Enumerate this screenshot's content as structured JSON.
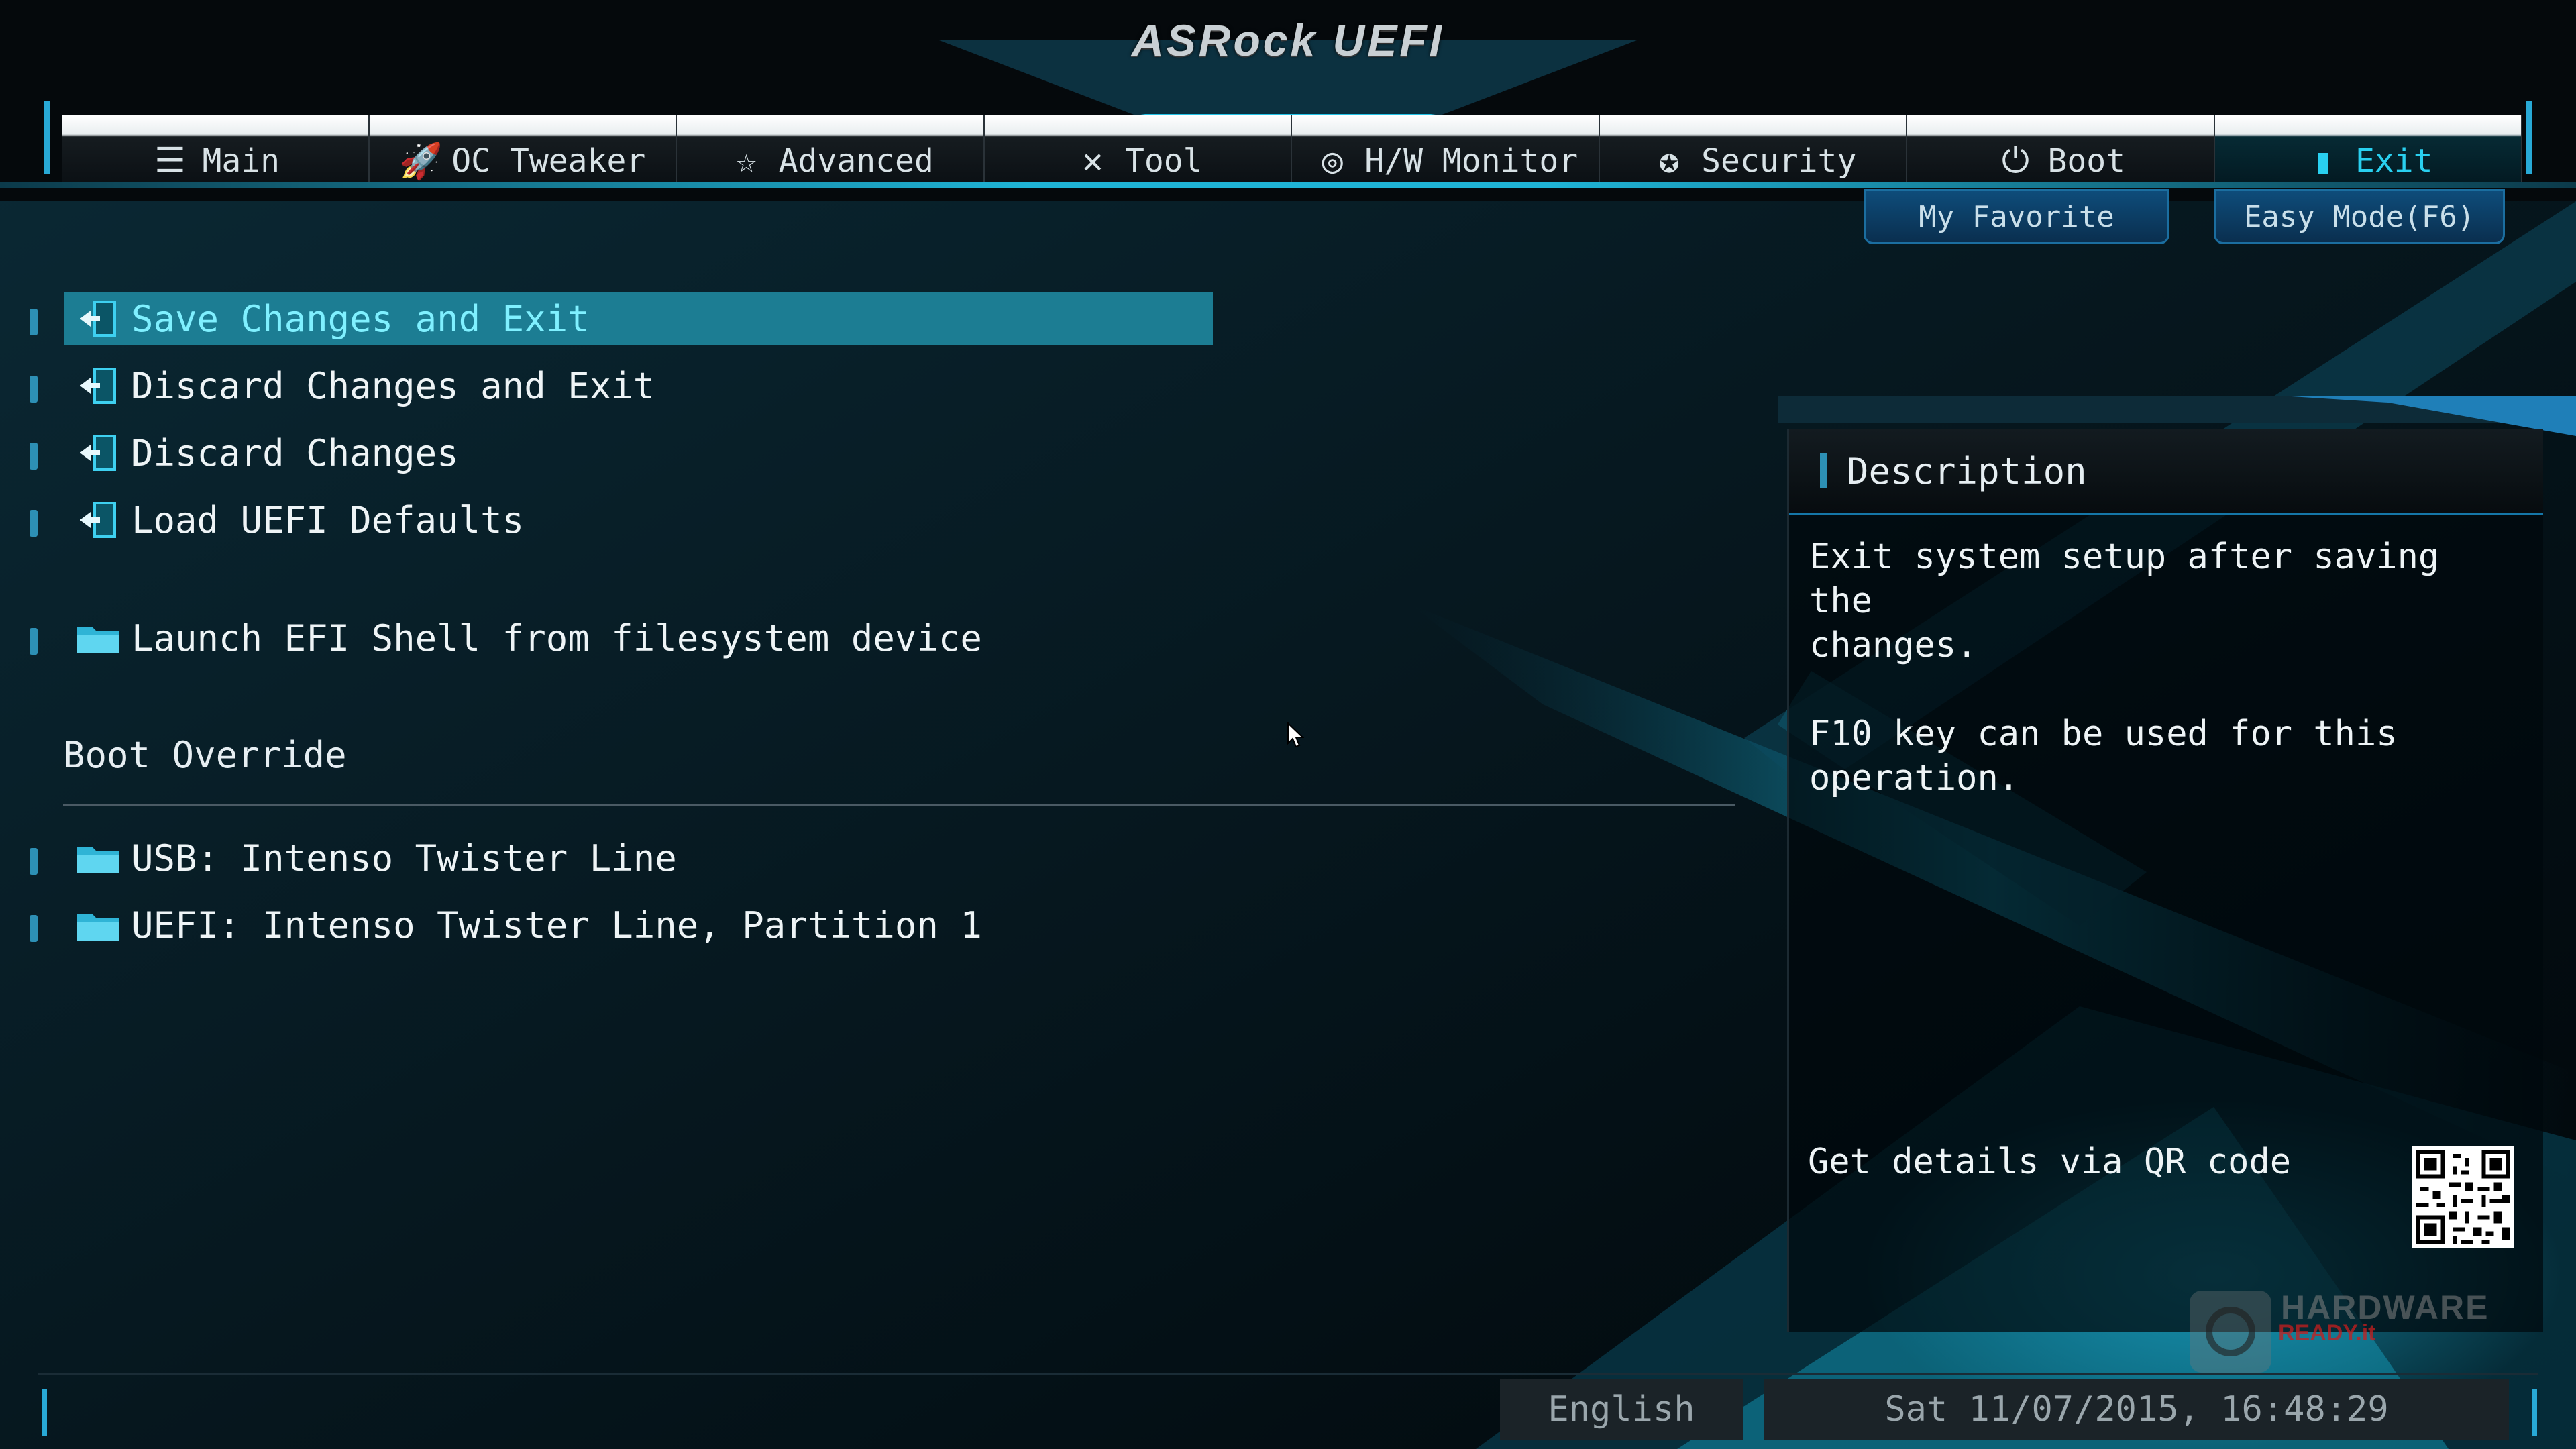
{
  "app": {
    "logo": "ASRock UEFI"
  },
  "tabs": [
    {
      "label": "Main",
      "icon": "list-icon"
    },
    {
      "label": "OC Tweaker",
      "icon": "rocket-icon"
    },
    {
      "label": "Advanced",
      "icon": "star-icon"
    },
    {
      "label": "Tool",
      "icon": "wrench-icon"
    },
    {
      "label": "H/W Monitor",
      "icon": "monitor-icon"
    },
    {
      "label": "Security",
      "icon": "shield-icon"
    },
    {
      "label": "Boot",
      "icon": "power-icon"
    },
    {
      "label": "Exit",
      "icon": "exit-icon"
    }
  ],
  "active_tab": "Exit",
  "quick_buttons": {
    "favorite": "My Favorite",
    "easy_mode": "Easy Mode(F6)"
  },
  "menu": {
    "items": [
      {
        "label": "Save Changes and Exit",
        "icon": "exit-door-icon",
        "selected": true
      },
      {
        "label": "Discard Changes and Exit",
        "icon": "exit-door-icon"
      },
      {
        "label": "Discard Changes",
        "icon": "exit-door-icon"
      },
      {
        "label": "Load UEFI Defaults",
        "icon": "exit-door-icon"
      },
      {
        "label": "Launch EFI Shell from filesystem device",
        "icon": "folder-icon"
      }
    ],
    "boot_override": {
      "title": "Boot Override",
      "items": [
        {
          "label": "USB: Intenso Twister Line",
          "icon": "folder-icon"
        },
        {
          "label": "UEFI: Intenso Twister Line, Partition 1",
          "icon": "folder-icon"
        }
      ]
    }
  },
  "description": {
    "title": "Description",
    "body": "Exit system setup after saving the\nchanges.\n\nF10 key can be used for this operation.",
    "qr_label": "Get details via QR code"
  },
  "footer": {
    "language": "English",
    "datetime": "Sat 11/07/2015, 16:48:29"
  },
  "watermark": {
    "line1": "HARDWARE",
    "line2": "READY.it"
  },
  "colors": {
    "accent": "#1c7d93",
    "highlight_text": "#7ff0ff",
    "tab_active": "#29d0f0"
  }
}
